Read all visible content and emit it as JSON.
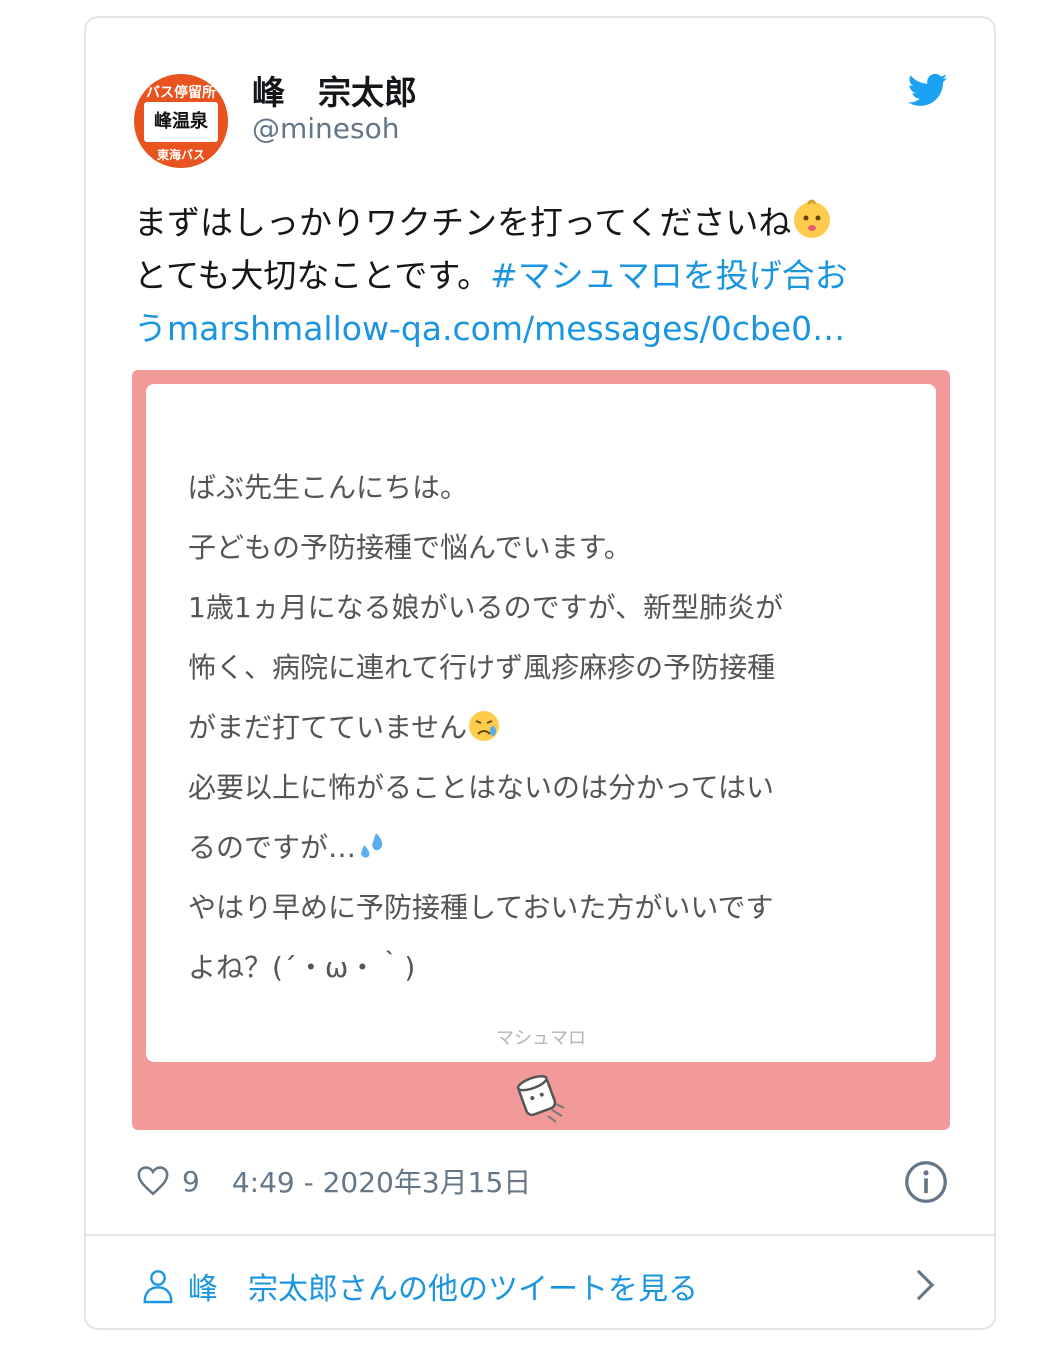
{
  "tweet": {
    "author_name": "峰　宗太郎",
    "author_handle": "@minesoh",
    "avatar": {
      "top": "バス停留所",
      "middle": "峰温泉",
      "bottom": "東海バス"
    },
    "text_line1": "まずはしっかりワクチンを打ってくださいね",
    "text_line2": "とても大切なことです。",
    "hashtag_part1": "#マシュマロを投げ合お",
    "hashtag_part2": "う",
    "link": "marshmallow-qa.com/messages/0cbe0…",
    "like_count": "9",
    "timestamp": "4:49 - 2020年3月15日",
    "more_tweets_label": "峰　宗太郎さんの他のツイートを見る"
  },
  "image_card": {
    "lines": [
      "ばぶ先生こんにちは。",
      "子どもの予防接種で悩んでいます。",
      "1歳1ヵ月になる娘がいるのですが、新型肺炎が",
      "怖く、病院に連れて行けず風疹麻疹の予防接種",
      "がまだ打てていません",
      "必要以上に怖がることはないのは分かってはい",
      "るのですが…",
      "やはり早めに予防接種しておいた方がいいです",
      "よね？(´・ω・｀)"
    ],
    "footer_label": "マシュマロ"
  },
  "icons": {
    "twitter": "twitter-bird-icon",
    "heart": "heart-icon",
    "info": "info-icon",
    "person": "person-icon",
    "chevron": "chevron-right-icon"
  },
  "colors": {
    "link": "#1b95e0",
    "card_border": "#e1e8ed",
    "image_bg": "#f29a9a",
    "muted": "#657786"
  }
}
